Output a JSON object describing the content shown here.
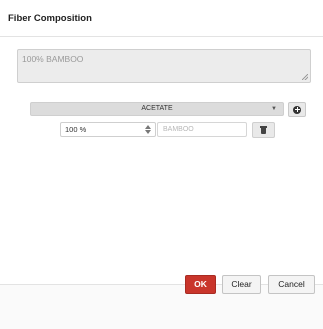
{
  "dialog": {
    "title": "Fiber Composition",
    "summary_value": "100% BAMBOO"
  },
  "composition": {
    "fiber_select_value": "ACETATE",
    "add_icon": "plus-circle-icon",
    "row": {
      "percent_value": "100 %",
      "fiber_name_placeholder": "BAMBOO",
      "delete_icon": "trash-icon"
    }
  },
  "footer": {
    "ok_label": "OK",
    "clear_label": "Clear",
    "cancel_label": "Cancel"
  },
  "colors": {
    "ok_button": "#c9352b",
    "summary_background": "#ececec"
  }
}
